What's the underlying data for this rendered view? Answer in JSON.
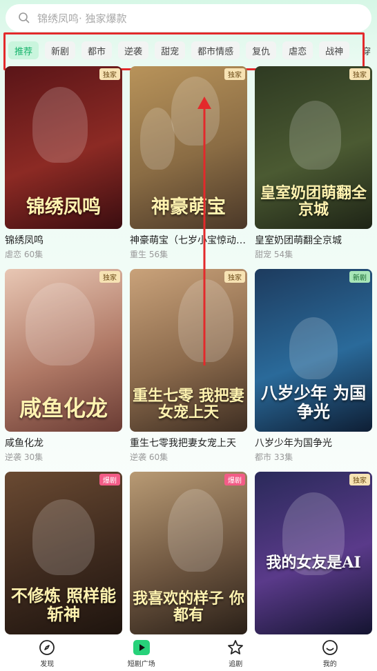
{
  "search": {
    "placeholder": "锦绣凤鸣· 独家爆款"
  },
  "tabs": [
    {
      "label": "推荐",
      "active": true
    },
    {
      "label": "新剧"
    },
    {
      "label": "都市"
    },
    {
      "label": "逆袭"
    },
    {
      "label": "甜宠"
    },
    {
      "label": "都市情感"
    },
    {
      "label": "复仇"
    },
    {
      "label": "虐恋"
    },
    {
      "label": "战神"
    },
    {
      "label": "穿"
    }
  ],
  "cards": [
    {
      "title": "锦绣凤鸣",
      "genre": "虐恋",
      "episodes": "60集",
      "badge": "独家",
      "badge_style": "gold",
      "art": "锦绣凤鸣",
      "colors": [
        "#5a1518",
        "#8c2a24",
        "#3a0d10"
      ]
    },
    {
      "title": "神豪萌宝（七岁小宝惊动…",
      "genre": "重生",
      "episodes": "56集",
      "badge": "独家",
      "badge_style": "gold",
      "art": "神豪萌宝",
      "colors": [
        "#b8935a",
        "#8a6c44",
        "#4a3828"
      ]
    },
    {
      "title": "皇室奶团萌翻全京城",
      "genre": "甜宠",
      "episodes": "54集",
      "badge": "独家",
      "badge_style": "gold",
      "art": "皇室奶团萌翻全京城",
      "colors": [
        "#2e3a22",
        "#4b5a32",
        "#1e2416"
      ]
    },
    {
      "title": "咸鱼化龙",
      "genre": "逆袭",
      "episodes": "30集",
      "badge": "独家",
      "badge_style": "gold",
      "art": "咸鱼化龙",
      "colors": [
        "#e8c7b4",
        "#b07966",
        "#6a3c34"
      ]
    },
    {
      "title": "重生七零我把妻女宠上天",
      "genre": "逆袭",
      "episodes": "60集",
      "badge": "独家",
      "badge_style": "gold",
      "art": "重生七零 我把妻女宠上天",
      "colors": [
        "#c9a27a",
        "#8b6a4c",
        "#3e2e22"
      ]
    },
    {
      "title": "八岁少年为国争光",
      "genre": "都市",
      "episodes": "33集",
      "badge": "新剧",
      "badge_style": "green",
      "art": "八岁少年 为国争光",
      "colors": [
        "#1d3b5e",
        "#2a6a9a",
        "#0e1e34"
      ]
    },
    {
      "title": "",
      "genre": "",
      "episodes": "",
      "badge": "爆剧",
      "badge_style": "pink",
      "art": "不修炼 照样能斩神",
      "colors": [
        "#6a4a32",
        "#3e2a1e",
        "#1e140e"
      ]
    },
    {
      "title": "",
      "genre": "",
      "episodes": "",
      "badge": "爆剧",
      "badge_style": "pink",
      "art": "我喜欢的样子 你都有",
      "colors": [
        "#b89a74",
        "#6e5640",
        "#2a2018"
      ]
    },
    {
      "title": "",
      "genre": "",
      "episodes": "",
      "badge": "独家",
      "badge_style": "gold",
      "art": "我的女友是AI",
      "colors": [
        "#2a2a5a",
        "#5a3a8a",
        "#141430"
      ]
    }
  ],
  "nav": [
    {
      "label": "发现",
      "icon": "compass-icon"
    },
    {
      "label": "短剧广场",
      "icon": "play-square-icon"
    },
    {
      "label": "追剧",
      "icon": "star-icon"
    },
    {
      "label": "我的",
      "icon": "smile-icon"
    }
  ]
}
